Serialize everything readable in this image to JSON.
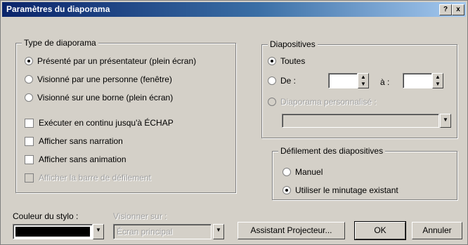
{
  "window": {
    "title": "Paramètres du diaporama",
    "help_icon": "?",
    "close_icon": "x"
  },
  "slideshow_type": {
    "legend": "Type de diaporama",
    "options": [
      "Présenté par un présentateur (plein écran)",
      "Visionné par une personne (fenêtre)",
      "Visionné sur une borne (plein écran)"
    ],
    "selected_index": 0,
    "checkboxes": [
      "Exécuter en continu jusqu'à ÉCHAP",
      "Afficher sans narration",
      "Afficher sans animation",
      "Afficher la barre de défilement"
    ]
  },
  "slides": {
    "legend": "Diapositives",
    "all_label": "Toutes",
    "from_label": "De :",
    "to_label": "à :",
    "custom_label": "Diaporama personnalisé :",
    "selected": "all"
  },
  "advance": {
    "legend": "Défilement des diapositives",
    "manual_label": "Manuel",
    "timings_label": "Utiliser le minutage existant",
    "selected": "timings"
  },
  "pen": {
    "label": "Couleur du stylo :",
    "color": "#000000"
  },
  "show_on": {
    "label": "Visionner sur :",
    "value": "Écran principal"
  },
  "buttons": {
    "projector": "Assistant Projecteur...",
    "ok": "OK",
    "cancel": "Annuler"
  }
}
